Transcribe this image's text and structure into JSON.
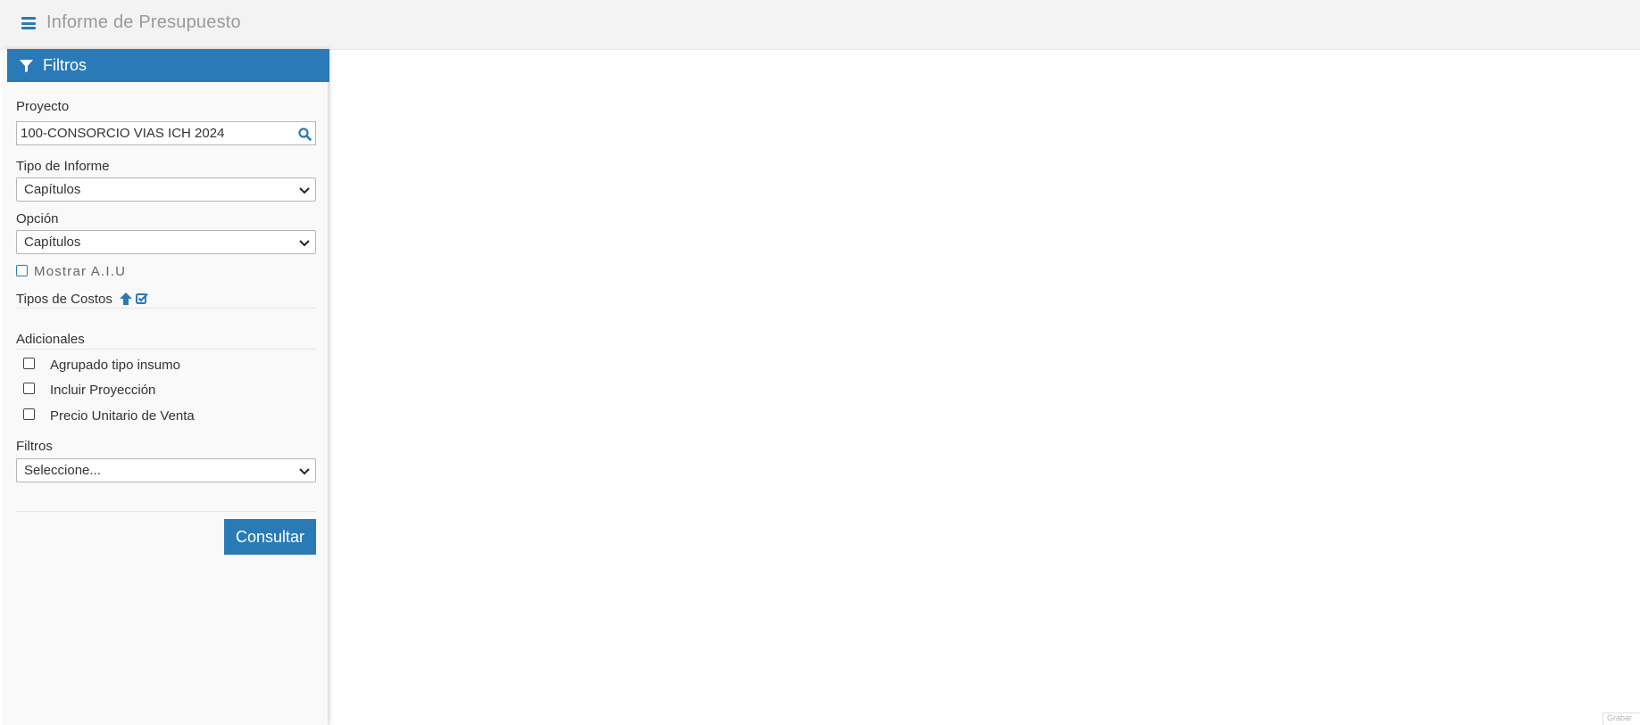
{
  "header": {
    "menu_icon": "hamburger-menu-icon",
    "title": "Informe de Presupuesto"
  },
  "filters_panel": {
    "title": "Filtros",
    "title_icon": "filter-funnel-icon",
    "accent_color": "#2a7ab8",
    "proyecto": {
      "label": "Proyecto",
      "value": "100-CONSORCIO VIAS ICH 2024",
      "action_icon": "search-icon"
    },
    "tipo_informe": {
      "label": "Tipo de Informe",
      "selected": "Capítulos"
    },
    "opcion": {
      "label": "Opción",
      "selected": "Capítulos"
    },
    "mostrar_aiu": {
      "label": "Mostrar A.I.U",
      "checked": false
    },
    "tipos_costos": {
      "label": "Tipos de Costos",
      "icons": [
        "arrow-up-icon",
        "check-square-icon"
      ]
    },
    "adicionales": {
      "label": "Adicionales",
      "options": [
        {
          "label": "Agrupado tipo insumo",
          "checked": false
        },
        {
          "label": "Incluir Proyección",
          "checked": false
        },
        {
          "label": "Precio Unitario de Venta",
          "checked": false
        }
      ]
    },
    "filtros": {
      "label": "Filtros",
      "selected": "Seleccione..."
    },
    "submit_label": "Consultar"
  },
  "footer": {
    "status_text": "Grabar"
  }
}
